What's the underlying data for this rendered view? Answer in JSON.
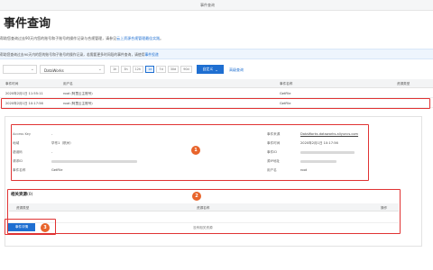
{
  "breadcrumb": [
    "事件查询"
  ],
  "page": {
    "title": "事件查询"
  },
  "notice1": {
    "prefix": "帮助您查询过去90天内您的账号和子账号的操作记录与合规管理，请参见",
    "link": "云上资源合规管理最佳实践",
    "suffix": "。"
  },
  "notice2": {
    "text": "帮助您查询过去90天内的您的账号和子账号的操作记录，若需要更多时间段的事件查询，请使用",
    "link": "事件投递"
  },
  "filters": {
    "field_value": "",
    "input_value": "DataWorks",
    "time_options": [
      "1h",
      "3h",
      "12h",
      "1d",
      "7d",
      "30d",
      "90d"
    ],
    "active_time": "1d",
    "custom_label": "自定义",
    "advanced_label": "高级查询"
  },
  "events_table": {
    "headers": [
      "事件时间",
      "用户名",
      "事件名称",
      "资源类型"
    ],
    "rows": [
      {
        "time": "2020年2月1日 11:55:11",
        "user": "root (阿里云主账号)",
        "event": "GetFile",
        "resource": ""
      },
      {
        "time": "2020年2月1日 10:17:56",
        "user": "root (阿里云主账号)",
        "event": "GetFile",
        "resource": ""
      }
    ]
  },
  "detail": {
    "left": [
      {
        "label": "Access Key",
        "value": "-"
      },
      {
        "label": "地域",
        "value": "华东1（杭州）"
      },
      {
        "label": "错误码",
        "value": "-"
      },
      {
        "label": "请求ID",
        "value": ""
      },
      {
        "label": "事件名称",
        "value": "GetFile"
      }
    ],
    "right": [
      {
        "label": "事件来源",
        "value": "DataWorks.dataworks.aliyuncs.com"
      },
      {
        "label": "事件时间",
        "value": "2020年2月1日 10:17:56"
      },
      {
        "label": "事件ID",
        "value": ""
      },
      {
        "label": "源IP地址",
        "value": ""
      },
      {
        "label": "用户名",
        "value": "root"
      }
    ],
    "badge": "1"
  },
  "resources": {
    "title": "相关资源",
    "count": "(0)",
    "headers": [
      "资源类型",
      "资源名称",
      "操作"
    ],
    "empty": "没有相关资源",
    "badge": "2"
  },
  "event_json": {
    "label": "事件详情",
    "badge": "3"
  },
  "colors": {
    "accent": "#1f6fd1",
    "highlight": "#e03333",
    "badge": "#e8642b"
  }
}
